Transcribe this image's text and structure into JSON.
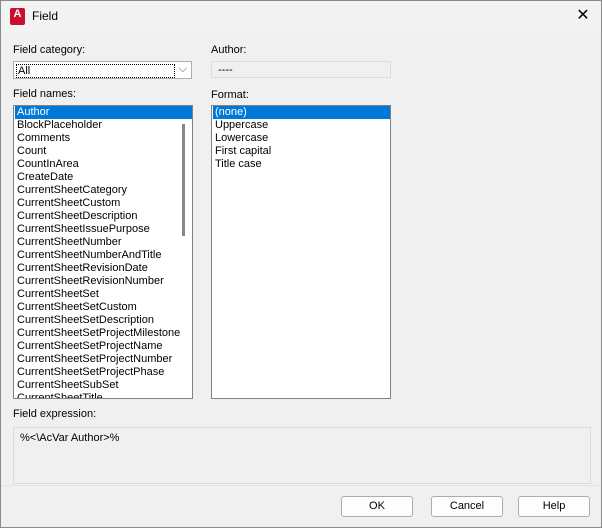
{
  "window": {
    "title": "Field",
    "logo_text": "A"
  },
  "field_category": {
    "label": "Field category:",
    "value": "All"
  },
  "field_names": {
    "label": "Field names:",
    "items": [
      "Author",
      "BlockPlaceholder",
      "Comments",
      "Count",
      "CountInArea",
      "CreateDate",
      "CurrentSheetCategory",
      "CurrentSheetCustom",
      "CurrentSheetDescription",
      "CurrentSheetIssuePurpose",
      "CurrentSheetNumber",
      "CurrentSheetNumberAndTitle",
      "CurrentSheetRevisionDate",
      "CurrentSheetRevisionNumber",
      "CurrentSheetSet",
      "CurrentSheetSetCustom",
      "CurrentSheetSetDescription",
      "CurrentSheetSetProjectMilestone",
      "CurrentSheetSetProjectName",
      "CurrentSheetSetProjectNumber",
      "CurrentSheetSetProjectPhase",
      "CurrentSheetSubSet",
      "CurrentSheetTitle"
    ],
    "selected": "Author"
  },
  "author": {
    "label": "Author:",
    "value": "----"
  },
  "format": {
    "label": "Format:",
    "items": [
      "(none)",
      "Uppercase",
      "Lowercase",
      "First capital",
      "Title case"
    ],
    "selected": "(none)"
  },
  "expression": {
    "label": "Field expression:",
    "value": "%<\\AcVar Author>%"
  },
  "buttons": {
    "ok": "OK",
    "cancel": "Cancel",
    "help": "Help"
  },
  "colors": {
    "selection": "#0078d7",
    "logo": "#c8102e"
  }
}
